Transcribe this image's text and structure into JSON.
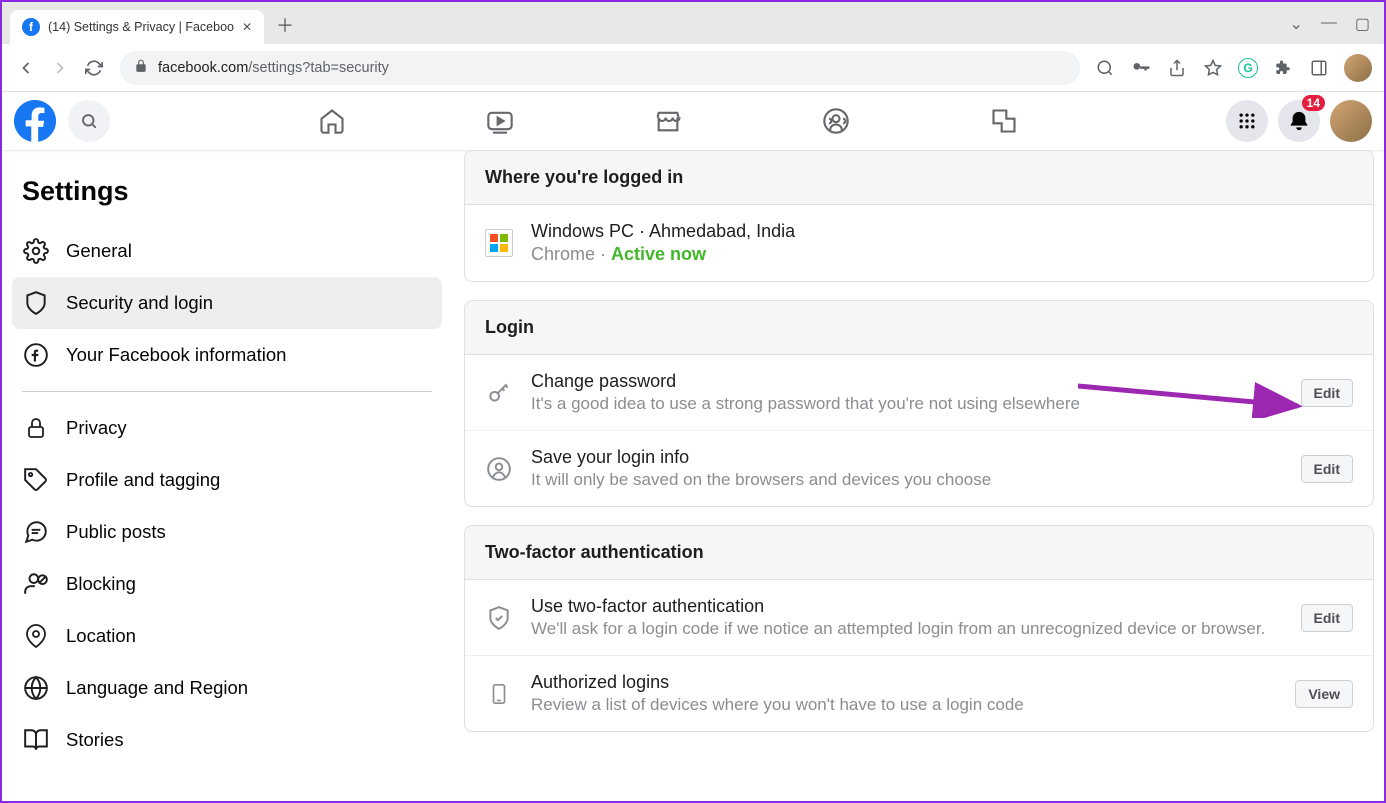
{
  "browser": {
    "tab_title": "(14) Settings & Privacy | Faceboo",
    "url_host": "facebook.com",
    "url_path": "/settings?tab=security"
  },
  "fb": {
    "badge_count": "14"
  },
  "sidebar": {
    "title": "Settings",
    "items": [
      {
        "label": "General"
      },
      {
        "label": "Security and login"
      },
      {
        "label": "Your Facebook information"
      },
      {
        "label": "Privacy"
      },
      {
        "label": "Profile and tagging"
      },
      {
        "label": "Public posts"
      },
      {
        "label": "Blocking"
      },
      {
        "label": "Location"
      },
      {
        "label": "Language and Region"
      },
      {
        "label": "Stories"
      }
    ]
  },
  "sections": {
    "logged_in": {
      "title": "Where you're logged in",
      "device": "Windows PC",
      "location": "Ahmedabad, India",
      "browser": "Chrome",
      "status": "Active now"
    },
    "login": {
      "title": "Login",
      "change_password": {
        "title": "Change password",
        "desc": "It's a good idea to use a strong password that you're not using elsewhere",
        "btn": "Edit"
      },
      "save_login": {
        "title": "Save your login info",
        "desc": "It will only be saved on the browsers and devices you choose",
        "btn": "Edit"
      }
    },
    "tfa": {
      "title": "Two-factor authentication",
      "use_tfa": {
        "title": "Use two-factor authentication",
        "desc": "We'll ask for a login code if we notice an attempted login from an unrecognized device or browser.",
        "btn": "Edit"
      },
      "authorized": {
        "title": "Authorized logins",
        "desc": "Review a list of devices where you won't have to use a login code",
        "btn": "View"
      }
    }
  }
}
